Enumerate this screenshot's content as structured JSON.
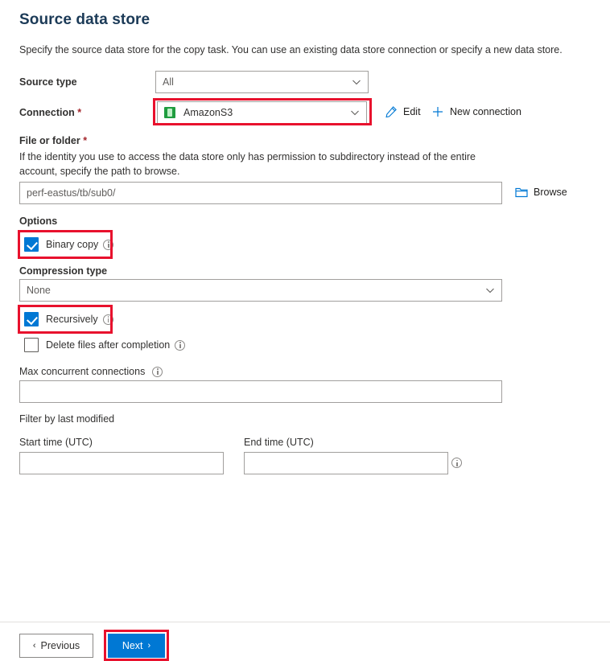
{
  "header": {
    "title": "Source data store",
    "description": "Specify the source data store for the copy task. You can use an existing data store connection or specify a new data store."
  },
  "form": {
    "source_type": {
      "label": "Source type",
      "value": "All"
    },
    "connection": {
      "label": "Connection",
      "required_mark": "*",
      "value": "AmazonS3",
      "icon": "amazon-s3-icon",
      "edit_label": "Edit",
      "new_connection_label": "New connection"
    },
    "file_or_folder": {
      "label": "File or folder",
      "required_mark": "*",
      "help_line1": "If the identity you use to access the data store only has permission to subdirectory instead of the entire",
      "help_line2": "account, specify the path to browse.",
      "value": "perf-eastus/tb/sub0/",
      "browse_label": "Browse"
    },
    "options": {
      "label": "Options",
      "binary_copy": {
        "label": "Binary copy",
        "checked": true
      },
      "compression_type": {
        "label": "Compression type",
        "value": "None"
      },
      "recursively": {
        "label": "Recursively",
        "checked": true
      },
      "delete_files": {
        "label": "Delete files after completion",
        "checked": false
      }
    },
    "max_concurrent_connections": {
      "label": "Max concurrent connections",
      "value": ""
    },
    "filter_by_last_modified": {
      "label": "Filter by last modified",
      "start_time": {
        "label": "Start time (UTC)",
        "value": ""
      },
      "end_time": {
        "label": "End time (UTC)",
        "value": ""
      }
    }
  },
  "footer": {
    "previous_label": "Previous",
    "previous_arrow": "‹",
    "next_label": "Next",
    "next_arrow": "›"
  },
  "colors": {
    "accent_blue": "#0078d4",
    "highlight_red": "#e8112d",
    "required_red": "#a4262c",
    "s3_green": "#1f9d3f",
    "title_blue": "#1b3a57"
  }
}
